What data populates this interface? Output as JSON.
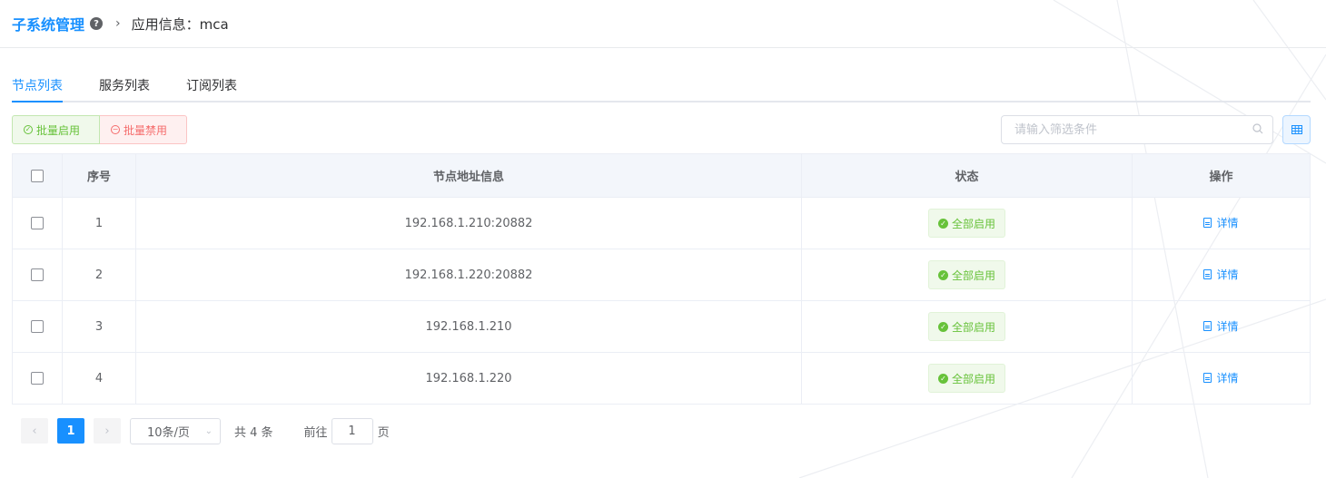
{
  "header": {
    "title": "子系统管理",
    "breadcrumb": "应用信息：mca"
  },
  "tabs": [
    {
      "label": "节点列表",
      "active": true
    },
    {
      "label": "服务列表",
      "active": false
    },
    {
      "label": "订阅列表",
      "active": false
    }
  ],
  "toolbar": {
    "enable_label": "批量启用",
    "disable_label": "批量禁用",
    "search_placeholder": "请输入筛选条件",
    "search_value": ""
  },
  "table": {
    "columns": [
      "序号",
      "节点地址信息",
      "状态",
      "操作"
    ],
    "rows": [
      {
        "index": "1",
        "address": "192.168.1.210:20882",
        "status": "全部启用",
        "action": "详情"
      },
      {
        "index": "2",
        "address": "192.168.1.220:20882",
        "status": "全部启用",
        "action": "详情"
      },
      {
        "index": "3",
        "address": "192.168.1.210",
        "status": "全部启用",
        "action": "详情"
      },
      {
        "index": "4",
        "address": "192.168.1.220",
        "status": "全部启用",
        "action": "详情"
      }
    ]
  },
  "pagination": {
    "current_page": "1",
    "page_size": "10条/页",
    "total": "共 4 条",
    "goto_label": "前往",
    "goto_value": "1",
    "page_unit": "页"
  },
  "colors": {
    "accent": "#1890ff",
    "success": "#67c23a",
    "danger": "#f56c6c"
  }
}
